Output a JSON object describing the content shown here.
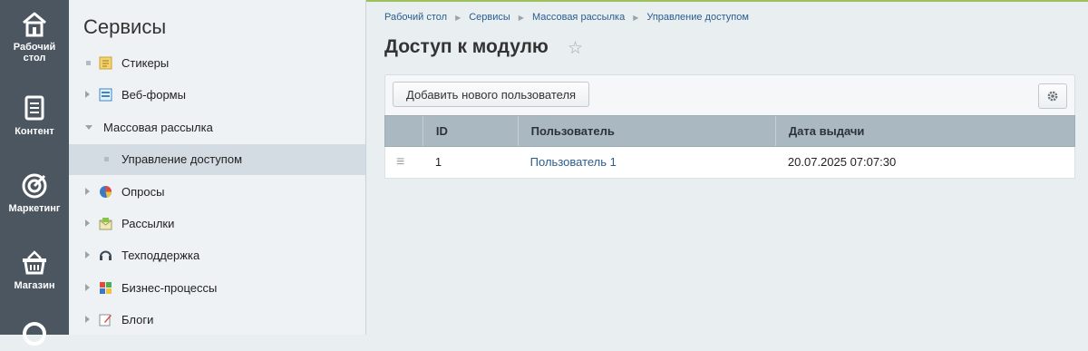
{
  "rail": {
    "items": [
      {
        "label_line1": "Рабочий",
        "label_line2": "стол",
        "icon": "home-icon"
      },
      {
        "label_line1": "Контент",
        "label_line2": "",
        "icon": "document-icon"
      },
      {
        "label_line1": "Маркетинг",
        "label_line2": "",
        "icon": "target-icon"
      },
      {
        "label_line1": "Магазин",
        "label_line2": "",
        "icon": "basket-icon"
      }
    ]
  },
  "tree": {
    "title": "Сервисы",
    "items": [
      {
        "label": "Стикеры",
        "icon": "sticker-icon"
      },
      {
        "label": "Веб-формы",
        "icon": "webform-icon"
      },
      {
        "label": "Массовая рассылка",
        "icon": ""
      },
      {
        "label": "Управление доступом",
        "icon": ""
      },
      {
        "label": "Опросы",
        "icon": "poll-icon"
      },
      {
        "label": "Рассылки",
        "icon": "mail-icon"
      },
      {
        "label": "Техподдержка",
        "icon": "headset-icon"
      },
      {
        "label": "Бизнес-процессы",
        "icon": "process-icon"
      },
      {
        "label": "Блоги",
        "icon": "blog-icon"
      }
    ]
  },
  "breadcrumbs": [
    "Рабочий стол",
    "Сервисы",
    "Массовая рассылка",
    "Управление доступом"
  ],
  "page": {
    "title": "Доступ к модулю"
  },
  "toolbar": {
    "add_label": "Добавить нового пользователя"
  },
  "table": {
    "columns": [
      "ID",
      "Пользователь",
      "Дата выдачи"
    ],
    "rows": [
      {
        "id": "1",
        "user": "Пользователь 1",
        "date": "20.07.2025 07:07:30"
      }
    ]
  }
}
